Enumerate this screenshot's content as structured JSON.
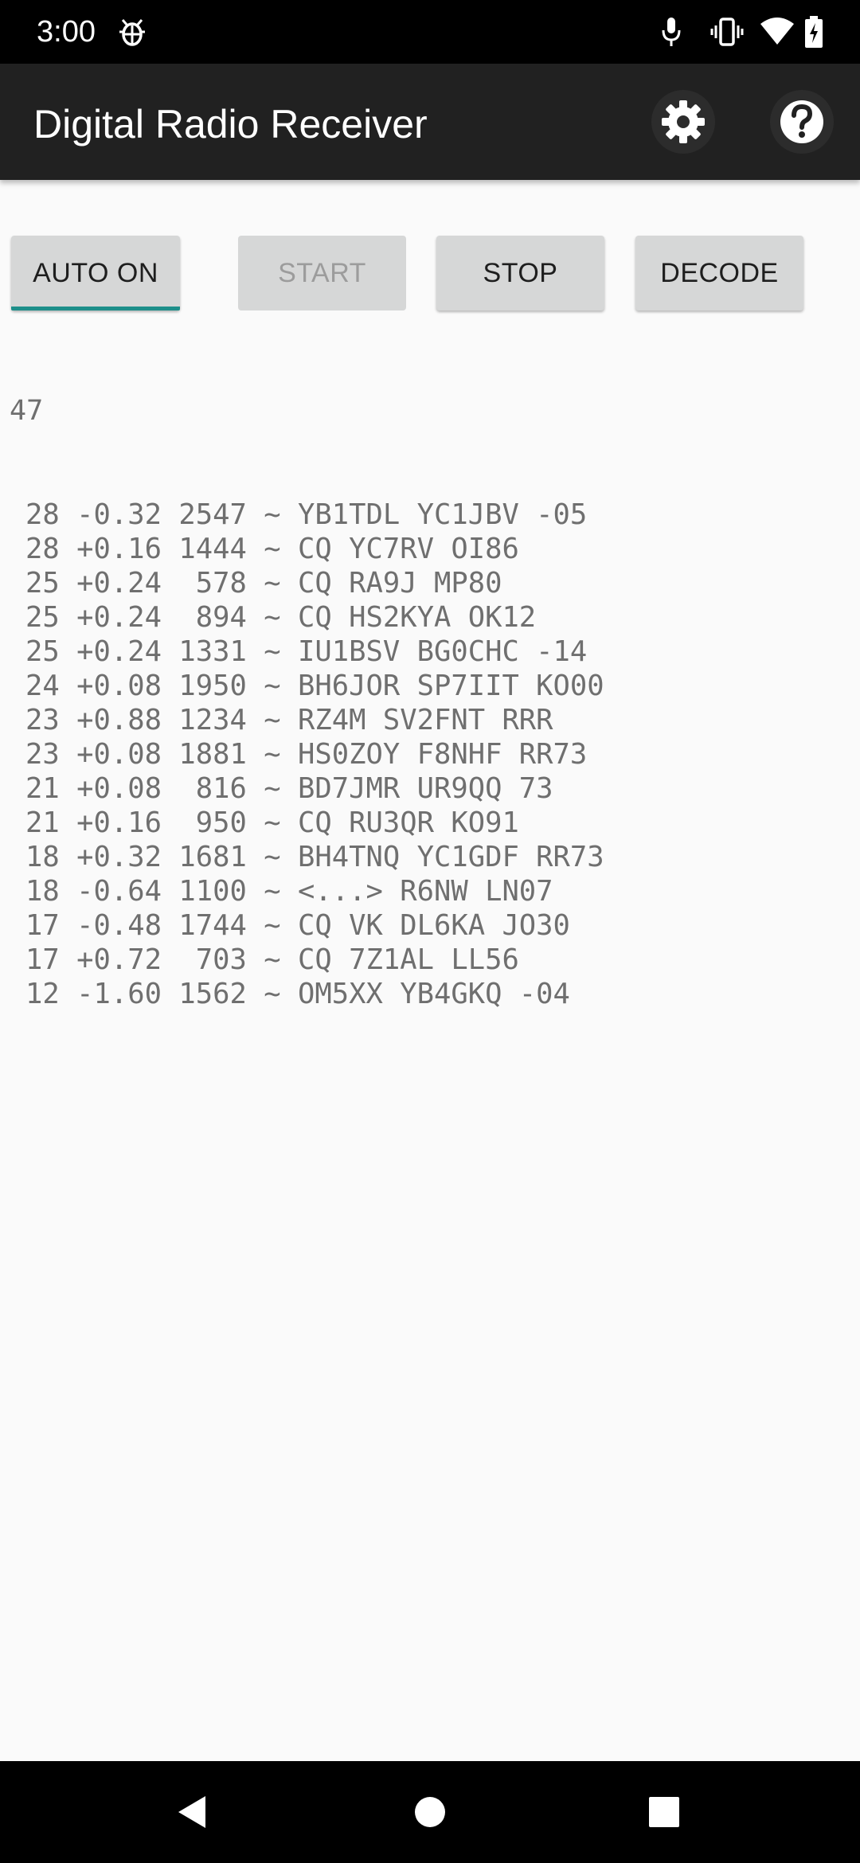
{
  "status_bar": {
    "time": "3:00",
    "icons": [
      "bug-notification-icon",
      "microphone-icon",
      "vibrate-icon",
      "wifi-icon",
      "battery-icon"
    ]
  },
  "app_bar": {
    "title": "Digital Radio Receiver",
    "actions": [
      "settings-gear-icon",
      "help-icon"
    ]
  },
  "controls": {
    "auto_label": "AUTO ON",
    "start_label": "START",
    "start_enabled": false,
    "stop_label": "STOP",
    "decode_label": "DECODE",
    "accent_color": "#1e8f8a"
  },
  "counter": "47",
  "decodes": [
    "28 -0.32 2547 ~ YB1TDL YC1JBV -05",
    "28 +0.16 1444 ~ CQ YC7RV OI86",
    "25 +0.24  578 ~ CQ RA9J MP80",
    "25 +0.24  894 ~ CQ HS2KYA OK12",
    "25 +0.24 1331 ~ IU1BSV BG0CHC -14",
    "24 +0.08 1950 ~ BH6JOR SP7IIT KO00",
    "23 +0.88 1234 ~ RZ4M SV2FNT RRR",
    "23 +0.08 1881 ~ HS0ZOY F8NHF RR73",
    "21 +0.08  816 ~ BD7JMR UR9QQ 73",
    "21 +0.16  950 ~ CQ RU3QR KO91",
    "18 +0.32 1681 ~ BH4TNQ YC1GDF RR73",
    "18 -0.64 1100 ~ <...> R6NW LN07",
    "17 -0.48 1744 ~ CQ VK DL6KA JO30",
    "17 +0.72  703 ~ CQ 7Z1AL LL56",
    "12 -1.60 1562 ~ OM5XX YB4GKQ -04"
  ],
  "nav_bar": {
    "buttons": [
      "back-icon",
      "home-icon",
      "recents-icon"
    ]
  }
}
